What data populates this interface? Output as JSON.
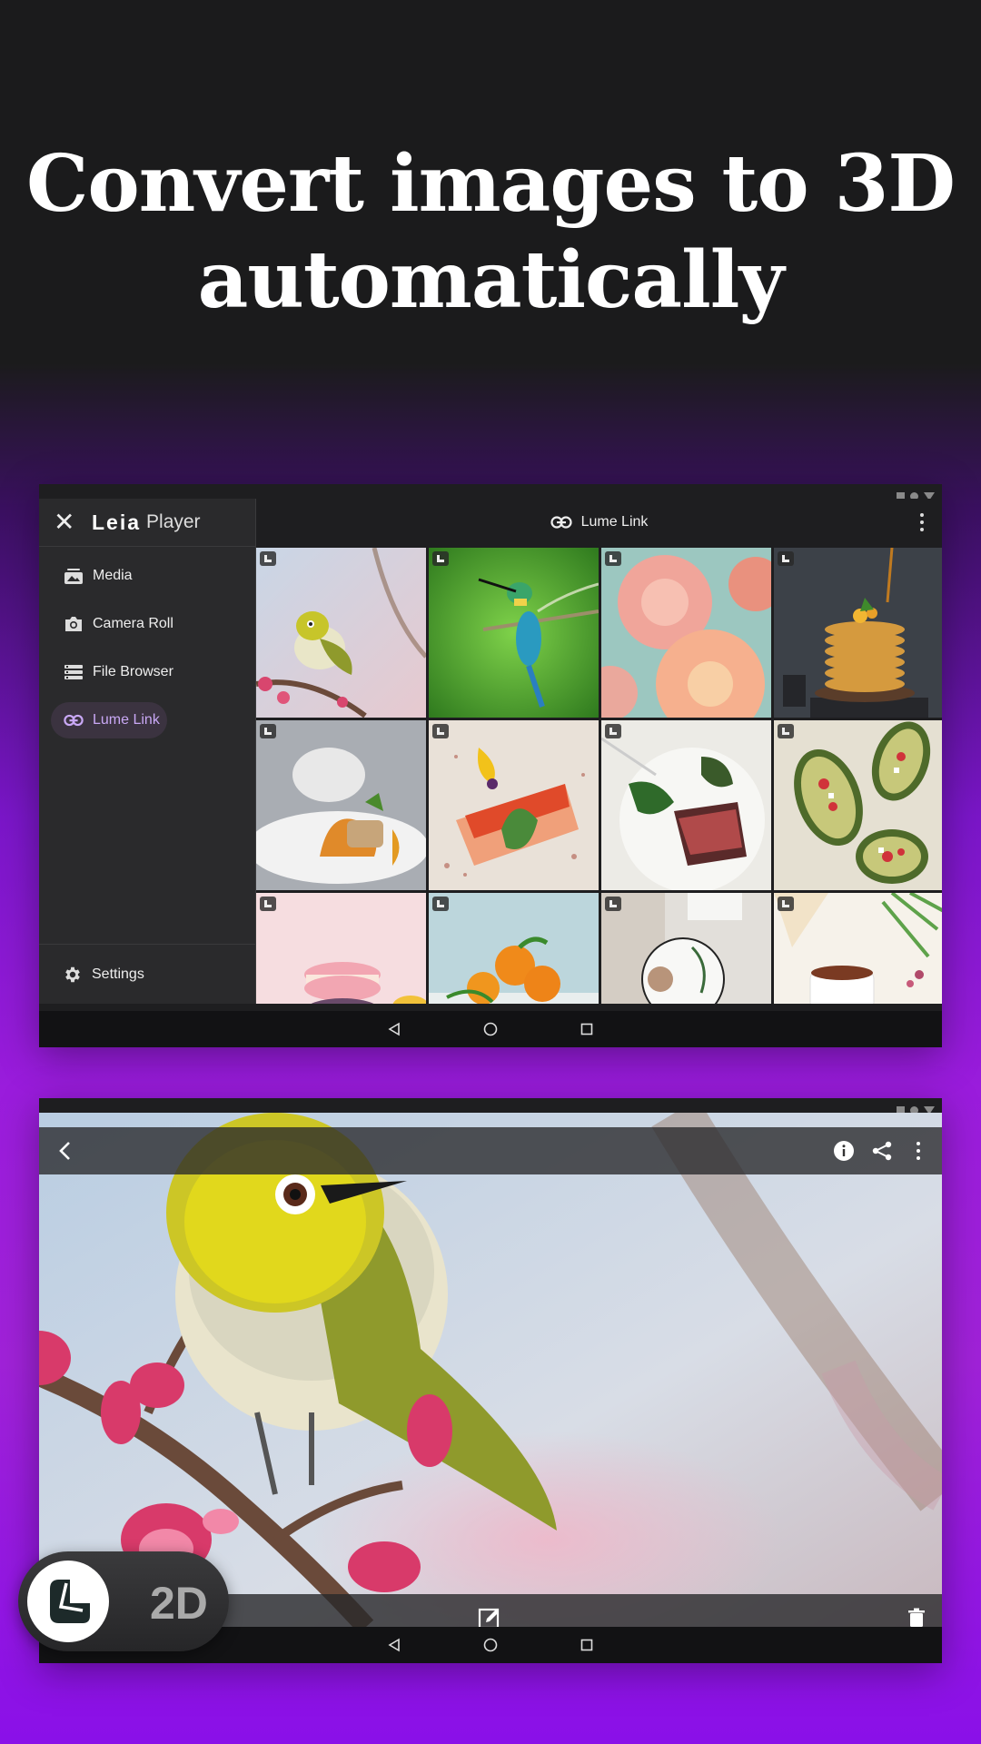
{
  "headline": {
    "line1": "Convert images to 3D",
    "line2": "automatically"
  },
  "library": {
    "brand": {
      "leia": "Leia",
      "player": "Player"
    },
    "nav": [
      {
        "label": "Media",
        "icon": "media-icon"
      },
      {
        "label": "Camera Roll",
        "icon": "camera-icon"
      },
      {
        "label": "File Browser",
        "icon": "file-browser-icon"
      },
      {
        "label": "Lume Link",
        "icon": "link-icon",
        "active": true
      }
    ],
    "settings_label": "Settings",
    "topbar_title": "Lume Link",
    "thumbnails": [
      "bird-on-blossom",
      "bee-eater-bird",
      "dahlia-flowers",
      "pancake-stack",
      "plated-dish",
      "salmon-with-roe",
      "steak-dish",
      "stuffed-avocados",
      "macarons",
      "oranges",
      "latte-top-view",
      "cup-of-tea"
    ]
  },
  "viewer": {
    "toggle_label": "2D",
    "icons": [
      "back-icon",
      "info-icon",
      "share-icon",
      "more-icon",
      "edit-icon",
      "delete-icon"
    ]
  },
  "colors": {
    "accent": "#c9a8f5",
    "bg_dark": "#1b1b1c",
    "purple": "#9a1cdc"
  }
}
